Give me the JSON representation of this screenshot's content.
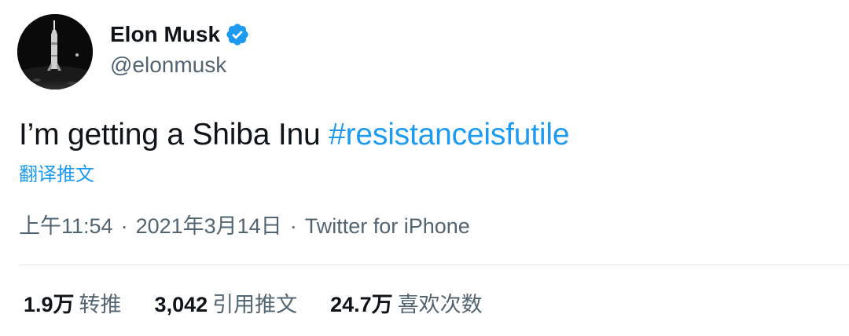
{
  "author": {
    "name": "Elon Musk",
    "handle": "@elonmusk",
    "verified": true
  },
  "tweet": {
    "text": "I’m getting a Shiba Inu ",
    "hashtag": "#resistanceisfutile",
    "translate_label": "翻译推文"
  },
  "meta": {
    "time": "上午11:54",
    "separator": "·",
    "date": "2021年3月14日",
    "source": "Twitter for iPhone"
  },
  "stats": {
    "retweets": {
      "count": "1.9万",
      "label": "转推"
    },
    "quotes": {
      "count": "3,042",
      "label": "引用推文"
    },
    "likes": {
      "count": "24.7万",
      "label": "喜欢次数"
    }
  },
  "colors": {
    "accent": "#1d9bf0",
    "text_primary": "#0f1419",
    "text_secondary": "#536471",
    "divider": "#e1e6ea"
  },
  "icons": {
    "verified": "verified-badge-icon"
  }
}
